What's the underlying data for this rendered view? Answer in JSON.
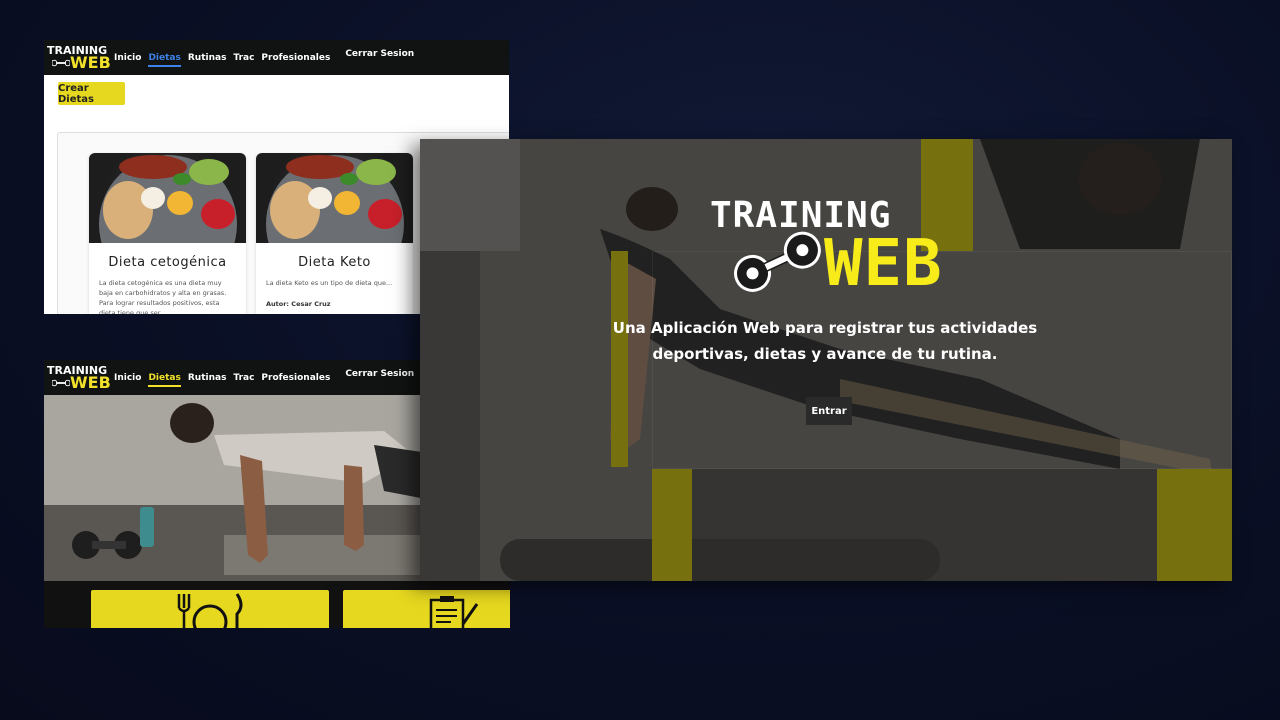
{
  "colors": {
    "background": "#0a0f25",
    "brand_yellow": "#f2e12a",
    "nav_bg": "#111312",
    "active_blue": "#3c82e8"
  },
  "logo": {
    "line1": "TRAINING",
    "line2": "WEB",
    "icon": "dumbbell-icon"
  },
  "dietas_page": {
    "nav": {
      "items": [
        "Inicio",
        "Dietas",
        "Rutinas",
        "Trac",
        "Profesionales"
      ],
      "active": "Dietas",
      "logout": "Cerrar Sesion"
    },
    "create_button": "Crear Dietas",
    "cards": [
      {
        "title": "Dieta cetogénica",
        "description": "La dieta cetogénica es una dieta muy baja en carbohidratos y alta en grasas. Para lograr resultados positivos, esta dieta tiene que ser",
        "author": ""
      },
      {
        "title": "Dieta Keto",
        "description": "La dieta Keto es un tipo de dieta que...",
        "author": "Autor: Cesar Cruz"
      }
    ]
  },
  "home_page": {
    "nav": {
      "items": [
        "Inicio",
        "Dietas",
        "Rutinas",
        "Trac",
        "Profesionales"
      ],
      "active": "Dietas",
      "logout": "Cerrar Sesion"
    },
    "feature_icons": [
      "fork-plate-knife-icon",
      "clipboard-icon"
    ]
  },
  "landing_page": {
    "tagline": "Una Aplicación Web para registrar tus actividades deportivas, dietas y avance de tu rutina.",
    "enter_button": "Entrar"
  }
}
